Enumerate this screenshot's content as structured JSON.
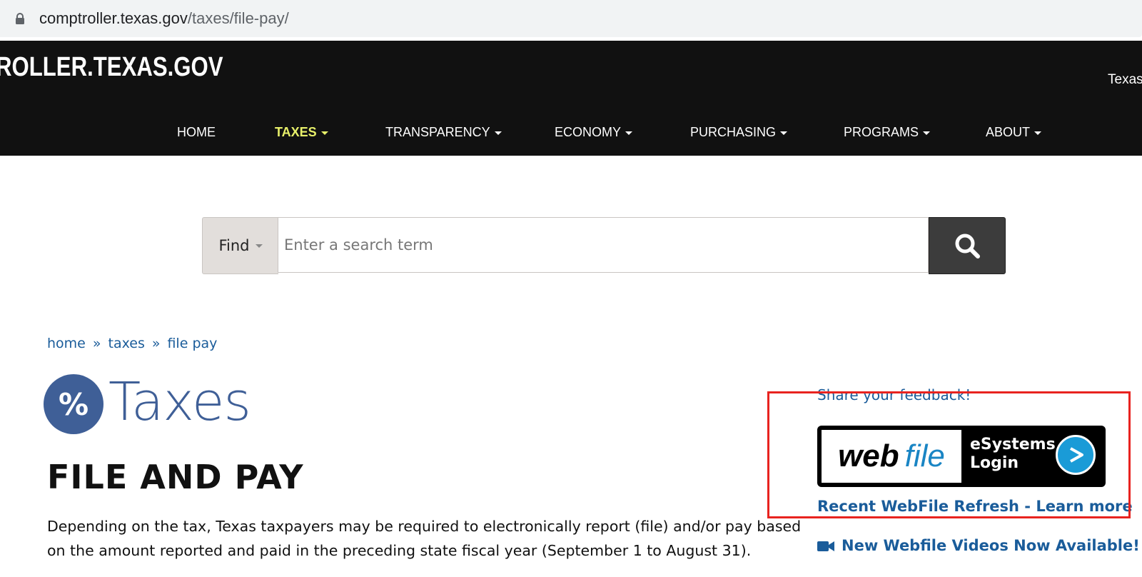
{
  "browser": {
    "url_domain": "comptroller.texas.gov",
    "url_path": "/taxes/file-pay/"
  },
  "header": {
    "logo_text": "ROLLER.TEXAS.GOV",
    "top_right_text": "Texas",
    "nav": [
      {
        "label": "HOME",
        "has_dropdown": false,
        "active": false
      },
      {
        "label": "TAXES",
        "has_dropdown": true,
        "active": true
      },
      {
        "label": "TRANSPARENCY",
        "has_dropdown": true,
        "active": false
      },
      {
        "label": "ECONOMY",
        "has_dropdown": true,
        "active": false
      },
      {
        "label": "PURCHASING",
        "has_dropdown": true,
        "active": false
      },
      {
        "label": "PROGRAMS",
        "has_dropdown": true,
        "active": false
      },
      {
        "label": "ABOUT",
        "has_dropdown": true,
        "active": false
      }
    ],
    "active_color": "#e8f06a"
  },
  "search": {
    "find_label": "Find",
    "placeholder": "Enter a search term",
    "button_icon": "search-icon"
  },
  "breadcrumb": {
    "items": [
      "home",
      "taxes",
      "file pay"
    ],
    "separator": "»"
  },
  "section": {
    "icon_symbol": "%",
    "title": "Taxes"
  },
  "main": {
    "page_title": "FILE AND PAY",
    "intro": "Depending on the tax, Texas taxpayers may be required to electronically report (file) and/or pay based on the amount reported and paid in the preceding state fiscal year (September 1 to August 31)."
  },
  "sidebar": {
    "feedback_link": "Share your feedback!",
    "webfile_button": {
      "word1": "web",
      "word2": "file",
      "line1": "eSystems",
      "line2": "Login"
    },
    "refresh_link": "Recent WebFile Refresh - Learn more",
    "videos_link": "New Webfile Videos Now Available!",
    "videos_icon": "video-camera-icon"
  },
  "colors": {
    "header_bg": "#111111",
    "link_blue": "#1a5c9a",
    "brand_blue": "#3f5f97",
    "highlight_red": "#e8231f"
  }
}
